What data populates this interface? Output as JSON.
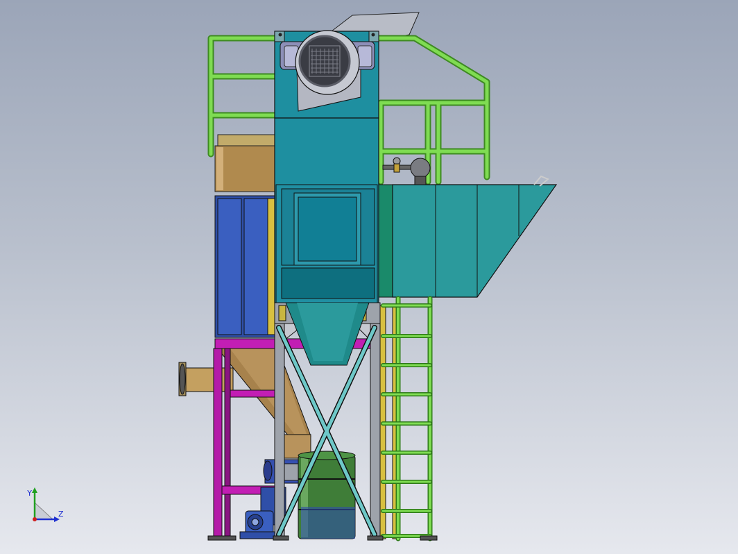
{
  "view": {
    "background_top": "#9ba5b8",
    "background_bottom": "#e6e8ee"
  },
  "triad": {
    "y_axis_label": "Y",
    "z_axis_label": "Z",
    "x_axis_color": "#d02020",
    "y_axis_color": "#20a020",
    "z_axis_color": "#2030d0"
  },
  "colors": {
    "body_teal": "#1e8fa0",
    "hopper_teal": "#2b9a9c",
    "railing_green": "#5db83a",
    "frame_magenta": "#b41aa8",
    "filter_blue": "#2f4fa8",
    "tank_tan": "#b08a4e",
    "drum_green": "#3f7d38",
    "steel_grey": "#9ea3ab"
  },
  "components": [
    "fan",
    "filter-housing",
    "inlet-hopper",
    "dust-hopper",
    "support-frame",
    "ladder",
    "guard-rail",
    "collection-drum",
    "motor-pump"
  ]
}
